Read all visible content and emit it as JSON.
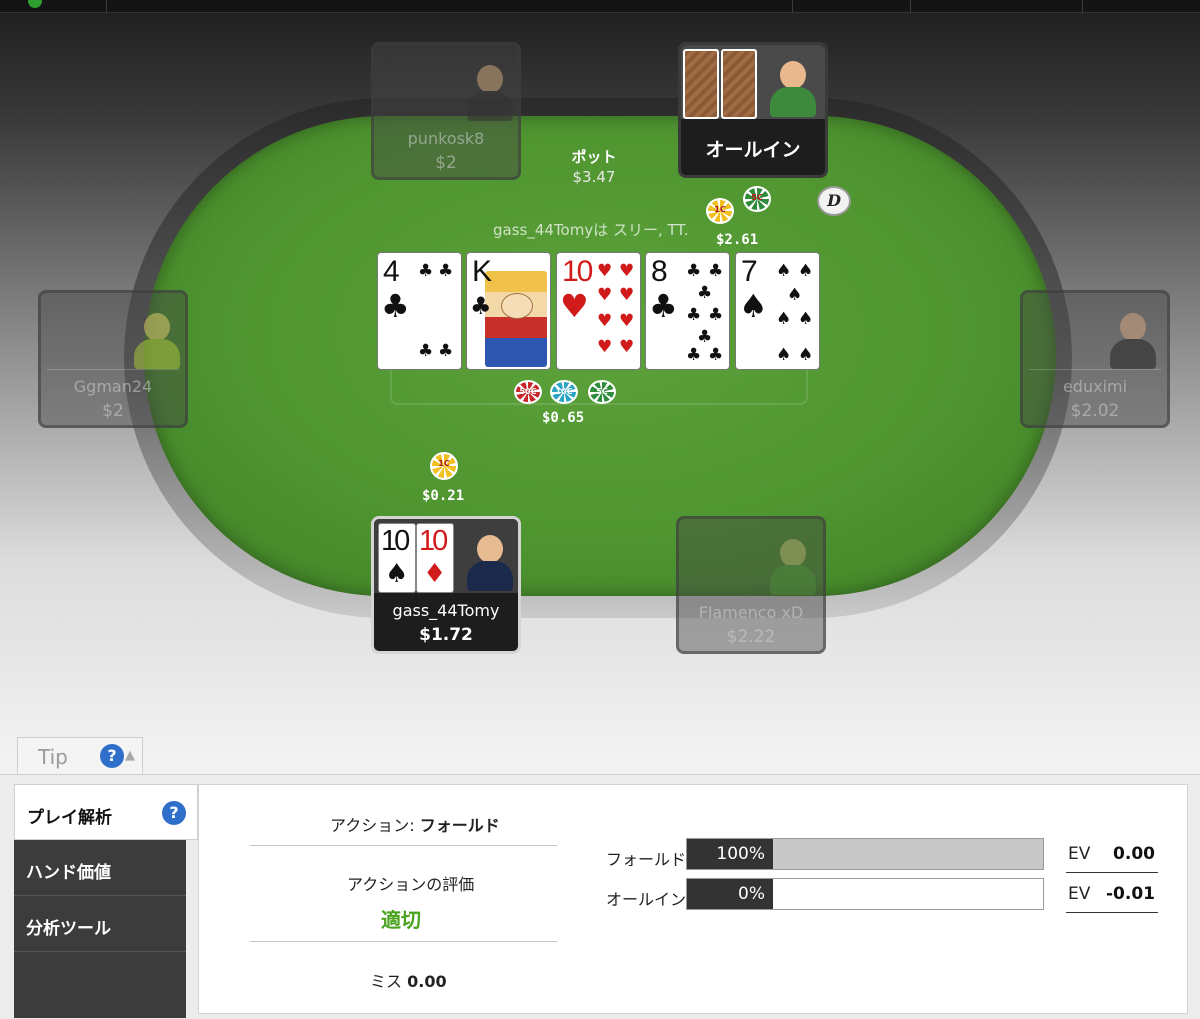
{
  "table": {
    "pot_label": "ポット",
    "pot_amount": "$3.47",
    "action_note": "gass_44Tomyは スリー, TT.",
    "seats": [
      {
        "name": "punkosk8",
        "stack": "$2"
      },
      {
        "name": "Ggman24",
        "stack": "$2"
      },
      {
        "name": "eduximi",
        "stack": "$2.02"
      },
      {
        "name": "Flamenco xD",
        "stack": "$2.22"
      },
      {
        "name": "gass_44Tomy",
        "stack": "$1.72",
        "hole_cards": [
          {
            "rank": "10",
            "suit": "♠"
          },
          {
            "rank": "10",
            "suit": "♦"
          }
        ]
      },
      {
        "status": "オールイン"
      }
    ],
    "board": [
      {
        "rank": "4",
        "suit": "♣"
      },
      {
        "rank": "K",
        "suit": "♣"
      },
      {
        "rank": "10",
        "suit": "♥"
      },
      {
        "rank": "8",
        "suit": "♣"
      },
      {
        "rank": "7",
        "suit": "♠"
      }
    ],
    "bets": {
      "allin_bet": {
        "amount": "$2.61",
        "chips": [
          "1C",
          "5C"
        ]
      },
      "center_pot": {
        "amount": "$0.65",
        "chips": [
          "50C",
          "10C",
          "5C"
        ]
      },
      "hero_bet": {
        "amount": "$0.21",
        "chips": [
          "1C"
        ]
      }
    },
    "dealer_button": "D"
  },
  "tip": {
    "label": "Tip",
    "help": "?",
    "caret": "▲"
  },
  "sidebar": {
    "items": [
      {
        "label": "プレイ解析",
        "help": "?"
      },
      {
        "label": "ハンド価値"
      },
      {
        "label": "分析ツール"
      }
    ]
  },
  "analysis": {
    "action_prefix": "アクション:",
    "action_value": "フォールド",
    "rating_label": "アクションの評価",
    "rating_value": "適切",
    "miss_prefix": "ミス",
    "miss_value": "0.00",
    "rows": [
      {
        "label": "フォールド",
        "pct": "100%",
        "pct_value": 100,
        "ev_label": "EV",
        "ev": "0.00"
      },
      {
        "label": "オールイン",
        "pct": "0%",
        "pct_value": 0,
        "ev_label": "EV",
        "ev": "-0.01"
      }
    ]
  },
  "colors": {
    "felt": "#4f9530",
    "good": "#4aa31e",
    "help_icon": "#2f6fca"
  }
}
